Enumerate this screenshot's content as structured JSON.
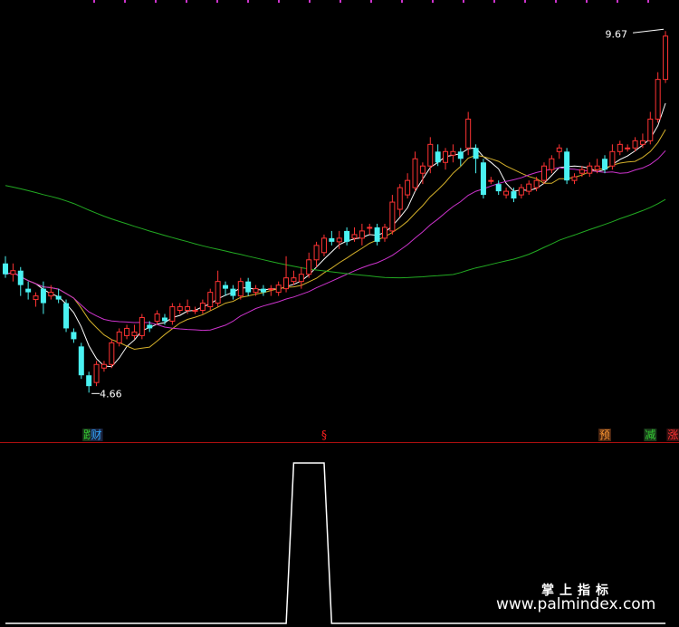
{
  "chart_data": [
    {
      "type": "candlestick",
      "title": "",
      "price_labels": {
        "high_label": "9.67",
        "low_label": "4.66"
      },
      "ylim": [
        4.3,
        10.0
      ],
      "candles": [
        [
          6.45,
          6.3,
          6.55,
          6.25
        ],
        [
          6.3,
          6.35,
          6.45,
          6.2
        ],
        [
          6.35,
          6.15,
          6.4,
          6.0
        ],
        [
          6.1,
          6.05,
          6.2,
          5.95
        ],
        [
          5.95,
          6.0,
          6.05,
          5.85
        ],
        [
          6.1,
          5.9,
          6.2,
          5.75
        ],
        [
          6.0,
          6.05,
          6.15,
          5.95
        ],
        [
          6.0,
          5.95,
          6.1,
          5.9
        ],
        [
          5.9,
          5.55,
          5.95,
          5.5
        ],
        [
          5.5,
          5.4,
          5.55,
          5.35
        ],
        [
          5.3,
          4.9,
          5.35,
          4.85
        ],
        [
          4.9,
          4.75,
          4.95,
          4.66
        ],
        [
          4.8,
          5.05,
          5.1,
          4.75
        ],
        [
          5.0,
          5.05,
          5.1,
          4.95
        ],
        [
          5.05,
          5.35,
          5.4,
          5.0
        ],
        [
          5.35,
          5.5,
          5.55,
          5.3
        ],
        [
          5.45,
          5.55,
          5.6,
          5.4
        ],
        [
          5.45,
          5.5,
          5.6,
          5.4
        ],
        [
          5.45,
          5.7,
          5.75,
          5.4
        ],
        [
          5.6,
          5.55,
          5.65,
          5.5
        ],
        [
          5.65,
          5.75,
          5.8,
          5.6
        ],
        [
          5.7,
          5.65,
          5.75,
          5.6
        ],
        [
          5.65,
          5.85,
          5.9,
          5.6
        ],
        [
          5.8,
          5.85,
          5.9,
          5.75
        ],
        [
          5.8,
          5.85,
          5.95,
          5.75
        ],
        [
          5.8,
          5.8,
          5.85,
          5.75
        ],
        [
          5.8,
          5.9,
          5.95,
          5.75
        ],
        [
          5.85,
          6.05,
          6.1,
          5.8
        ],
        [
          5.9,
          6.2,
          6.35,
          5.85
        ],
        [
          6.15,
          6.1,
          6.2,
          6.0
        ],
        [
          6.1,
          6.0,
          6.15,
          5.95
        ],
        [
          6.0,
          6.2,
          6.25,
          5.95
        ],
        [
          6.2,
          6.05,
          6.25,
          6.0
        ],
        [
          6.05,
          6.1,
          6.15,
          6.0
        ],
        [
          6.1,
          6.05,
          6.15,
          6.0
        ],
        [
          6.1,
          6.1,
          6.15,
          6.0
        ],
        [
          6.05,
          6.15,
          6.2,
          6.0
        ],
        [
          6.1,
          6.25,
          6.55,
          6.05
        ],
        [
          6.2,
          6.25,
          6.35,
          6.15
        ],
        [
          6.2,
          6.3,
          6.4,
          6.1
        ],
        [
          6.3,
          6.5,
          6.6,
          6.25
        ],
        [
          6.5,
          6.7,
          6.75,
          6.4
        ],
        [
          6.6,
          6.8,
          6.85,
          6.55
        ],
        [
          6.8,
          6.75,
          6.9,
          6.7
        ],
        [
          6.75,
          6.8,
          6.9,
          6.65
        ],
        [
          6.9,
          6.75,
          6.95,
          6.7
        ],
        [
          6.8,
          6.85,
          6.95,
          6.75
        ],
        [
          6.8,
          6.9,
          7.0,
          6.7
        ],
        [
          6.95,
          6.95,
          7.0,
          6.85
        ],
        [
          6.95,
          6.75,
          7.0,
          6.7
        ],
        [
          6.8,
          6.95,
          7.0,
          6.75
        ],
        [
          6.9,
          7.3,
          7.4,
          6.85
        ],
        [
          7.2,
          7.5,
          7.55,
          7.1
        ],
        [
          7.4,
          7.6,
          7.7,
          7.35
        ],
        [
          7.5,
          7.9,
          8.0,
          7.45
        ],
        [
          7.7,
          7.8,
          7.85,
          7.55
        ],
        [
          7.8,
          8.1,
          8.2,
          7.7
        ],
        [
          8.0,
          7.85,
          8.1,
          7.8
        ],
        [
          7.85,
          8.0,
          8.05,
          7.75
        ],
        [
          7.95,
          8.0,
          8.1,
          7.85
        ],
        [
          8.0,
          7.9,
          8.05,
          7.8
        ],
        [
          8.05,
          8.45,
          8.55,
          7.95
        ],
        [
          8.05,
          7.9,
          8.1,
          7.7
        ],
        [
          7.85,
          7.4,
          7.9,
          7.35
        ],
        [
          7.6,
          7.6,
          7.65,
          7.55
        ],
        [
          7.55,
          7.45,
          7.6,
          7.4
        ],
        [
          7.4,
          7.45,
          7.5,
          7.35
        ],
        [
          7.45,
          7.35,
          7.5,
          7.3
        ],
        [
          7.4,
          7.5,
          7.55,
          7.35
        ],
        [
          7.45,
          7.55,
          7.6,
          7.4
        ],
        [
          7.5,
          7.6,
          7.65,
          7.45
        ],
        [
          7.6,
          7.8,
          7.85,
          7.55
        ],
        [
          7.75,
          7.9,
          7.95,
          7.7
        ],
        [
          8.0,
          8.05,
          8.1,
          7.9
        ],
        [
          8.0,
          7.6,
          8.05,
          7.55
        ],
        [
          7.6,
          7.65,
          7.7,
          7.55
        ],
        [
          7.7,
          7.75,
          7.8,
          7.65
        ],
        [
          7.7,
          7.8,
          7.85,
          7.65
        ],
        [
          7.75,
          7.8,
          7.9,
          7.7
        ],
        [
          7.9,
          7.75,
          7.95,
          7.7
        ],
        [
          7.8,
          8.0,
          8.1,
          7.75
        ],
        [
          8.0,
          8.1,
          8.15,
          7.95
        ],
        [
          8.05,
          8.05,
          8.1,
          8.0
        ],
        [
          8.05,
          8.15,
          8.2,
          8.0
        ],
        [
          8.1,
          8.15,
          8.25,
          8.05
        ],
        [
          8.15,
          8.45,
          8.55,
          8.1
        ],
        [
          8.45,
          9.0,
          9.1,
          8.4
        ],
        [
          9.0,
          9.6,
          9.67,
          8.95
        ]
      ],
      "signals": [
        {
          "label": "跌",
          "color": "#33cc33",
          "bg": "#1a3a1a",
          "index": 11
        },
        {
          "label": "财",
          "color": "#33aaff",
          "bg": "#1a2440",
          "index": 12
        },
        {
          "label": "§",
          "color": "#ff2020",
          "bg": "#000000",
          "index": 42
        },
        {
          "label": "预",
          "color": "#ff9933",
          "bg": "#4a2510",
          "index": 79
        },
        {
          "label": "减",
          "color": "#33cc33",
          "bg": "#1a3a1a",
          "index": 85
        },
        {
          "label": "涨",
          "color": "#ff3333",
          "bg": "#3a1010",
          "index": 88
        }
      ],
      "moving_averages": [
        {
          "color": "#ffffff",
          "period": 5
        },
        {
          "color": "#d4b02a",
          "period": 10
        },
        {
          "color": "#cc33cc",
          "period": 20
        },
        {
          "color": "#22aa22",
          "period": 60,
          "seed": [
            7.6,
            7.5
          ]
        }
      ],
      "colors": {
        "up": "#ff3333",
        "down": "#4af2f2",
        "border": "#b01010",
        "top_marks": "#cc33cc"
      }
    },
    {
      "type": "step",
      "title": "",
      "ylim": [
        0,
        1
      ],
      "values": [
        0,
        0,
        0,
        0,
        0,
        0,
        0,
        0,
        0,
        0,
        0,
        0,
        0,
        0,
        0,
        0,
        0,
        0,
        0,
        0,
        0,
        0,
        0,
        0,
        0,
        0,
        0,
        0,
        0,
        0,
        0,
        0,
        0,
        0,
        0,
        0,
        0,
        0,
        1,
        1,
        1,
        1,
        1,
        0,
        0,
        0,
        0,
        0,
        0,
        0,
        0,
        0,
        0,
        0,
        0,
        0,
        0,
        0,
        0,
        0,
        0,
        0,
        0,
        0,
        0,
        0,
        0,
        0,
        0,
        0,
        0,
        0,
        0,
        0,
        0,
        0,
        0,
        0,
        0,
        0,
        0,
        0,
        0,
        0,
        0,
        0,
        0,
        0
      ],
      "line_color": "#ffffff"
    }
  ],
  "watermark": {
    "text_cn": "掌上指标",
    "url": "www.palmindex.com"
  }
}
